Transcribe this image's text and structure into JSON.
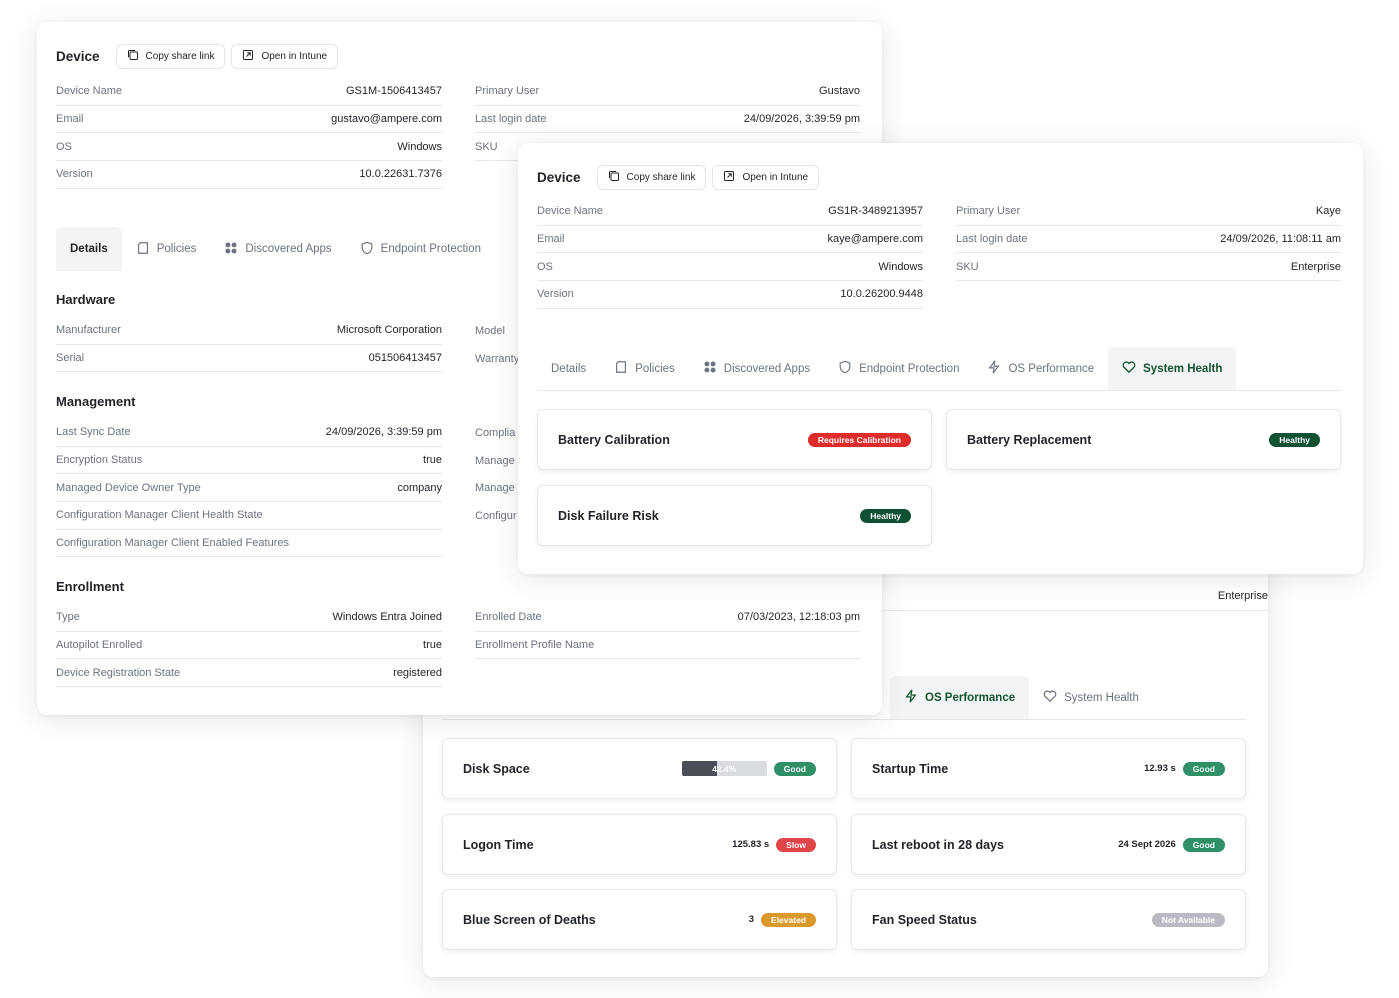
{
  "common": {
    "device_title": "Device",
    "copy_label": "Copy share link",
    "open_label": "Open in Intune"
  },
  "tabs": {
    "details": "Details",
    "policies": "Policies",
    "apps": "Discovered Apps",
    "endpoint": "Endpoint Protection",
    "osperf": "OS Performance",
    "health": "System Health"
  },
  "left": {
    "device_name_k": "Device Name",
    "device_name_v": "GS1M-1506413457",
    "email_k": "Email",
    "email_v": "gustavo@ampere.com",
    "os_k": "OS",
    "os_v": "Windows",
    "version_k": "Version",
    "version_v": "10.0.22631.7376",
    "primary_user_k": "Primary User",
    "primary_user_v": "Gustavo",
    "last_login_k": "Last login date",
    "last_login_v": "24/09/2026, 3:39:59 pm",
    "sku_k": "SKU",
    "hardware_title": "Hardware",
    "manufacturer_k": "Manufacturer",
    "manufacturer_v": "Microsoft Corporation",
    "serial_k": "Serial",
    "serial_v": "051506413457",
    "model_k": "Model",
    "warranty_k": "Warranty",
    "management_title": "Management",
    "last_sync_k": "Last Sync Date",
    "last_sync_v": "24/09/2026, 3:39:59 pm",
    "encryption_k": "Encryption Status",
    "encryption_v": "true",
    "owner_k": "Managed Device Owner Type",
    "owner_v": "company",
    "cm_health_k": "Configuration Manager Client Health State",
    "cm_features_k": "Configuration Manager Client Enabled Features",
    "compliance_k": "Complia",
    "managed1_k": "Manage",
    "managed2_k": "Manage",
    "config_k": "Configur",
    "enrollment_title": "Enrollment",
    "type_k": "Type",
    "type_v": "Windows Entra Joined",
    "autopilot_k": "Autopilot Enrolled",
    "autopilot_v": "true",
    "reg_state_k": "Device Registration State",
    "reg_state_v": "registered",
    "enrolled_date_k": "Enrolled Date",
    "enrolled_date_v": "07/03/2023, 12:18:03 pm",
    "profile_k": "Enrollment Profile Name"
  },
  "front": {
    "device_name_k": "Device Name",
    "device_name_v": "GS1R-3489213957",
    "email_k": "Email",
    "email_v": "kaye@ampere.com",
    "os_k": "OS",
    "os_v": "Windows",
    "version_k": "Version",
    "version_v": "10.0.26200.9448",
    "primary_user_k": "Primary User",
    "primary_user_v": "Kaye",
    "last_login_k": "Last login date",
    "last_login_v": "24/09/2026, 11:08:11 am",
    "sku_k": "SKU",
    "sku_v": "Enterprise",
    "cards": [
      {
        "title": "Battery Calibration",
        "status": "Requires Calibration"
      },
      {
        "title": "Battery Replacement",
        "status": "Healthy"
      },
      {
        "title": "Disk Failure Risk",
        "status": "Healthy"
      }
    ]
  },
  "back": {
    "sku_v": "Enterprise",
    "cards": [
      {
        "title": "Disk Space",
        "value": "42.4%",
        "progress": 0.42,
        "status": "Good"
      },
      {
        "title": "Startup Time",
        "value": "12.93 s",
        "status": "Good"
      },
      {
        "title": "Logon Time",
        "value": "125.83 s",
        "status": "Slow"
      },
      {
        "title": "Last reboot in 28 days",
        "value": "24 Sept 2026",
        "status": "Good"
      },
      {
        "title": "Blue Screen of Deaths",
        "value": "3",
        "status": "Elevated"
      },
      {
        "title": "Fan Speed Status",
        "value": "",
        "status": "Not Available"
      }
    ]
  },
  "colors": {
    "good": "#2f8f67",
    "slow": "#e0454a",
    "elevated": "#d99a2b",
    "na": "#b8bcc2",
    "requires": "#e02b2b",
    "healthy": "#0f5132"
  }
}
